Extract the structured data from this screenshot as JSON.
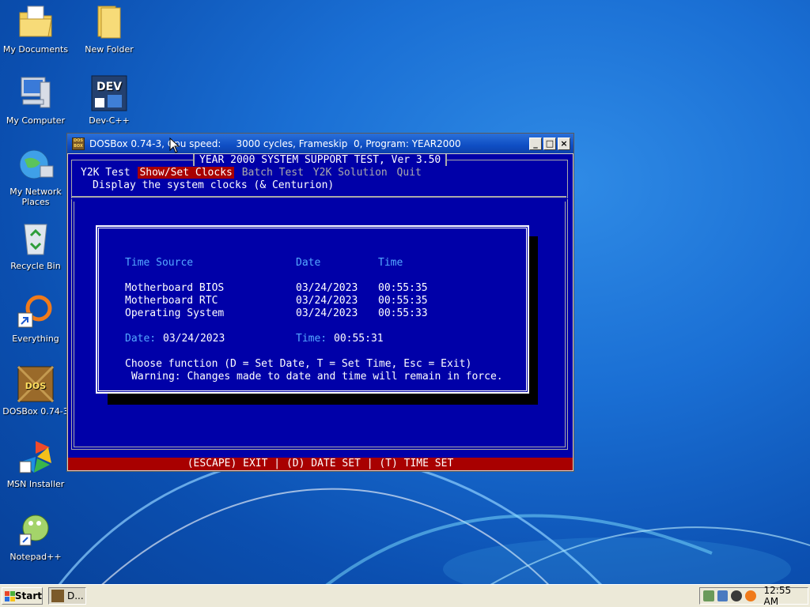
{
  "desktop": {
    "icons": [
      {
        "label": "My Documents"
      },
      {
        "label": "New Folder"
      },
      {
        "label": "My Computer"
      },
      {
        "label": "Dev-C++",
        "badge": "DEV"
      },
      {
        "label": "My Network Places"
      },
      {
        "label": "Recycle Bin"
      },
      {
        "label": "Everything"
      },
      {
        "label": "DOSBox 0.74-3",
        "badge": "DOS"
      },
      {
        "label": "MSN Installer"
      },
      {
        "label": "Notepad++"
      }
    ]
  },
  "window": {
    "title": "DOSBox 0.74-3, Cpu speed:     3000 cycles, Frameskip  0, Program: YEAR2000",
    "icon_text": "DOS BOX",
    "buttons": {
      "minimize": "_",
      "maximize": "□",
      "close": "×"
    }
  },
  "dos": {
    "header": "YEAR 2000 SYSTEM SUPPORT TEST, Ver 3.50",
    "menu": [
      {
        "label": "Y2K Test",
        "selected": false
      },
      {
        "label": "Show/Set Clocks",
        "selected": true
      },
      {
        "label": "Batch Test",
        "selected": false
      },
      {
        "label": "Y2K Solution",
        "selected": false
      },
      {
        "label": "Quit",
        "selected": false
      }
    ],
    "description": "Display the system clocks (& Centurion)",
    "table": {
      "headers": [
        "Time Source",
        "Date",
        "Time"
      ],
      "rows": [
        [
          "Motherboard BIOS",
          "03/24/2023",
          "00:55:35"
        ],
        [
          "Motherboard RTC",
          "03/24/2023",
          "00:55:35"
        ],
        [
          "Operating System",
          "03/24/2023",
          "00:55:33"
        ]
      ]
    },
    "current": {
      "date_label": "Date:",
      "date_value": "03/24/2023",
      "time_label": "Time:",
      "time_value": "00:55:31"
    },
    "prompt": "Choose function (D = Set Date, T = Set Time, Esc = Exit)",
    "warning": "Warning: Changes made to date and time will remain in force.",
    "status_bar": "(ESCAPE) EXIT | (D) DATE SET | (T) TIME SET"
  },
  "taskbar": {
    "start_label": "Start",
    "task_label": "D...",
    "clock": "12:55 AM"
  }
}
